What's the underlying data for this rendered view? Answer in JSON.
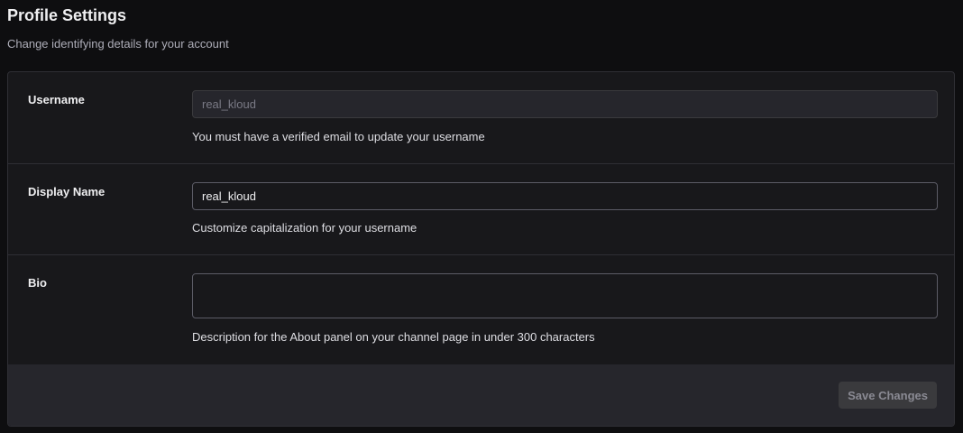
{
  "header": {
    "title": "Profile Settings",
    "subtitle": "Change identifying details for your account"
  },
  "username": {
    "label": "Username",
    "value": "real_kloud",
    "disabled": true,
    "help": "You must have a verified email to update your username"
  },
  "display_name": {
    "label": "Display Name",
    "value": "real_kloud",
    "help": "Customize capitalization for your username"
  },
  "bio": {
    "label": "Bio",
    "value": "",
    "help": "Description for the About panel on your channel page in under 300 characters"
  },
  "footer": {
    "save_label": "Save Changes",
    "save_disabled": true
  },
  "colors": {
    "background": "#0e0e10",
    "card": "#18181b",
    "footer": "#26262c",
    "border": "#2f2f35"
  }
}
